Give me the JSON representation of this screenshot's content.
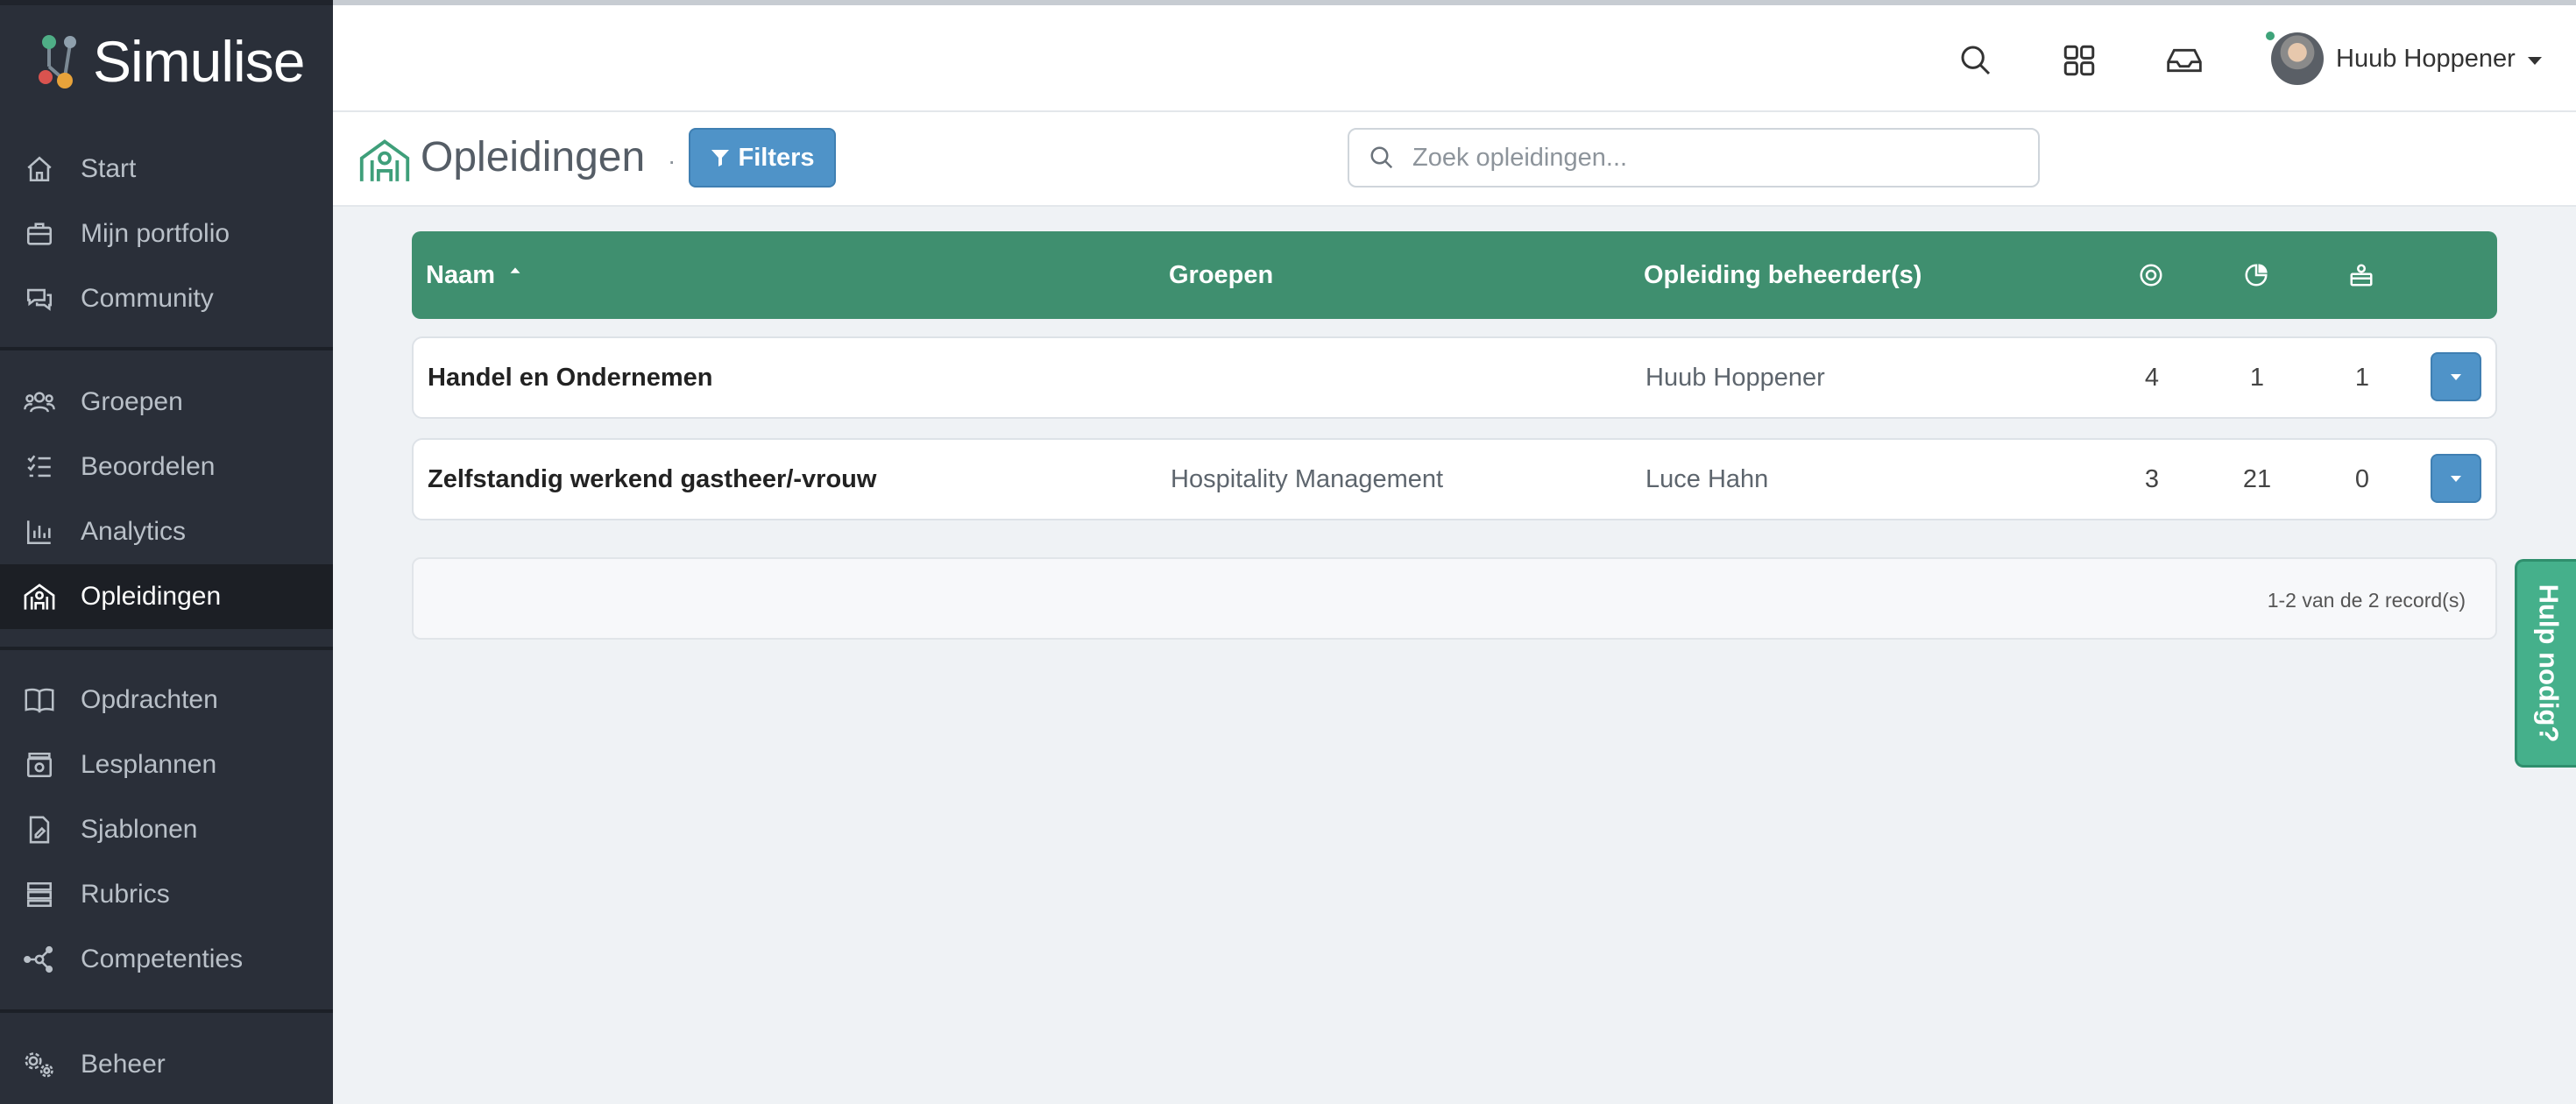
{
  "app": {
    "name": "Simulise"
  },
  "sidebar": {
    "items": [
      {
        "label": "Start",
        "icon": "home-icon"
      },
      {
        "label": "Mijn portfolio",
        "icon": "briefcase-icon"
      },
      {
        "label": "Community",
        "icon": "chat-icon"
      },
      {
        "label": "Groepen",
        "icon": "users-icon"
      },
      {
        "label": "Beoordelen",
        "icon": "checklist-icon"
      },
      {
        "label": "Analytics",
        "icon": "bar-chart-icon"
      },
      {
        "label": "Opleidingen",
        "icon": "school-icon",
        "active": true
      },
      {
        "label": "Opdrachten",
        "icon": "book-icon"
      },
      {
        "label": "Lesplannen",
        "icon": "archive-icon"
      },
      {
        "label": "Sjablonen",
        "icon": "document-icon"
      },
      {
        "label": "Rubrics",
        "icon": "rubric-icon"
      },
      {
        "label": "Competenties",
        "icon": "network-icon"
      },
      {
        "label": "Beheer",
        "icon": "gears-icon"
      }
    ]
  },
  "header": {
    "user_name": "Huub Hoppener",
    "icons": [
      "search-icon",
      "apps-grid-icon",
      "inbox-icon"
    ]
  },
  "page": {
    "title": "Opleidingen",
    "separator": "·",
    "filters_label": "Filters",
    "search_placeholder": "Zoek opleidingen..."
  },
  "table": {
    "columns": {
      "naam": "Naam",
      "groepen": "Groepen",
      "beheerders": "Opleiding beheerder(s)",
      "icon1": "target-icon",
      "icon2": "pie-chart-icon",
      "icon3": "user-box-icon"
    },
    "rows": [
      {
        "naam": "Handel en Ondernemen",
        "groepen": "",
        "beheerder": "Huub Hoppener",
        "c1": "4",
        "c2": "1",
        "c3": "1"
      },
      {
        "naam": "Zelfstandig werkend gastheer/-vrouw",
        "groepen": "Hospitality Management",
        "beheerder": "Luce Hahn",
        "c1": "3",
        "c2": "21",
        "c3": "0"
      }
    ],
    "records_text": "1-2 van de 2 record(s)"
  },
  "help_tab": {
    "label": "Hulp nodig?"
  },
  "colors": {
    "sidebar": "#2a2f39",
    "table_header": "#3f8f6f",
    "primary_button": "#4f93c8",
    "help_tab": "#45b08b"
  }
}
